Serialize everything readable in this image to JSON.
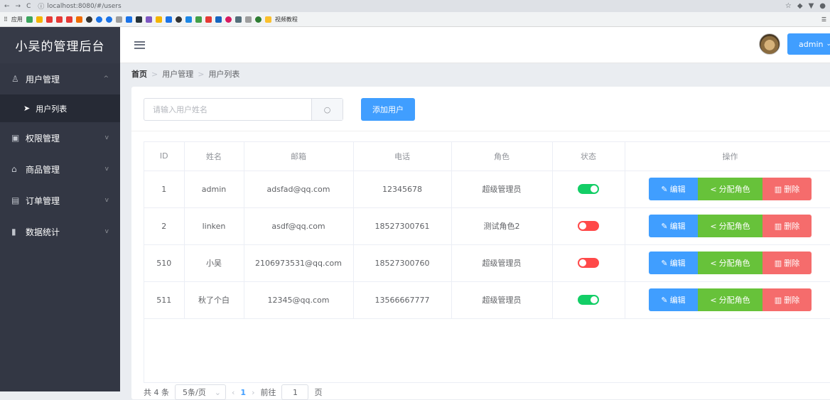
{
  "browser": {
    "url": "localhost:8080/#/users",
    "bookmark_apps": "应用",
    "bookmark_folder": "视频教程"
  },
  "sidebar": {
    "title": "小吴的管理后台",
    "items": [
      {
        "label": "用户管理",
        "icon": "user-icon",
        "chevron": "^"
      },
      {
        "label": "权限管理",
        "icon": "lock-icon",
        "chevron": "v"
      },
      {
        "label": "商品管理",
        "icon": "bag-icon",
        "chevron": "v"
      },
      {
        "label": "订单管理",
        "icon": "order-icon",
        "chevron": "v"
      },
      {
        "label": "数据统计",
        "icon": "chart-icon",
        "chevron": "v"
      }
    ],
    "sub_item": {
      "label": "用户列表",
      "icon": "send-icon"
    }
  },
  "header": {
    "user_label": "admin"
  },
  "breadcrumb": [
    "首页",
    "用户管理",
    "用户列表"
  ],
  "toolbar": {
    "search_placeholder": "请输入用户姓名",
    "add_label": "添加用户"
  },
  "table": {
    "columns": [
      "ID",
      "姓名",
      "邮箱",
      "电话",
      "角色",
      "状态",
      "操作"
    ],
    "rows": [
      {
        "id": "1",
        "name": "admin",
        "email": "adsfad@qq.com",
        "phone": "12345678",
        "role": "超级管理员",
        "status": true
      },
      {
        "id": "2",
        "name": "linken",
        "email": "asdf@qq.com",
        "phone": "18527300761",
        "role": "测试角色2",
        "status": false
      },
      {
        "id": "510",
        "name": "小吴",
        "email": "2106973531@qq.com",
        "phone": "18527300760",
        "role": "超级管理员",
        "status": false
      },
      {
        "id": "511",
        "name": "秋了个白",
        "email": "12345@qq.com",
        "phone": "13566667777",
        "role": "超级管理员",
        "status": true
      }
    ],
    "actions": {
      "edit": "编辑",
      "assign": "分配角色",
      "delete": "删除"
    }
  },
  "pagination": {
    "total": "共 4 条",
    "page_size": "5条/页",
    "current": "1",
    "goto_label": "前往",
    "goto_value": "1",
    "page_suffix": "页"
  },
  "colors": {
    "primary": "#409eff",
    "success": "#67c23a",
    "danger": "#f56c6c",
    "switch_on": "#13ce66",
    "switch_off": "#ff4949",
    "sidebar_bg": "#333744"
  }
}
